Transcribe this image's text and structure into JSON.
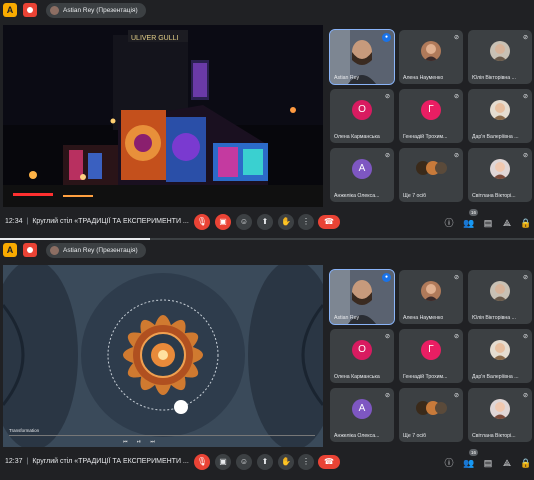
{
  "screens": [
    {
      "presenter_chip": "Astian Rey (Презентація)",
      "time": "12:34",
      "meeting_title": "Круглий стіл «ТРАДИЦІЇ ТА ЕКСПЕРИМЕНТИ ...",
      "participant_count": "16",
      "stage_image": "night-city-led-building",
      "progress_fraction": 0.28
    },
    {
      "presenter_chip": "Astian Rey (Презентація)",
      "time": "12:37",
      "meeting_title": "Круглий стіл «ТРАДИЦІЇ ТА ЕКСПЕРИМЕНТИ ...",
      "participant_count": "16",
      "stage_image": "kaleidoscope-fractal-video",
      "video_label": "Transformation"
    }
  ],
  "participants": [
    {
      "name": "Astian Rey",
      "type": "video",
      "mic": "on"
    },
    {
      "name": "Алена Науменко",
      "type": "photo",
      "mic": "off"
    },
    {
      "name": "Юлія Вікторівна ...",
      "type": "photo",
      "mic": "off"
    },
    {
      "name": "Олена Карманська",
      "type": "letter",
      "letter": "О",
      "color": "#d81b60",
      "mic": "off"
    },
    {
      "name": "Геннадій Трохим...",
      "type": "letter",
      "letter": "Г",
      "color": "#e91e63",
      "mic": "off"
    },
    {
      "name": "Дар'я Валеріївна ...",
      "type": "photo",
      "mic": "off"
    },
    {
      "name": "Анжеліка Олекса...",
      "type": "letter",
      "letter": "А",
      "color": "#7e57c2",
      "mic": "off"
    },
    {
      "name": "Ще 7 осіб",
      "type": "group",
      "mic": "off"
    },
    {
      "name": "Світлана Вікторі...",
      "type": "photo",
      "mic": "off"
    }
  ],
  "icons": {
    "ext": "A",
    "mic_off": "mic-off-icon",
    "camera_off": "camera-off-icon",
    "emoji": "emoji-icon",
    "present": "present-icon",
    "hand": "raise-hand-icon",
    "more": "more-icon",
    "end_call": "end-call-icon",
    "info": "info-icon",
    "people": "people-icon",
    "chat": "chat-icon",
    "activities": "activities-icon",
    "lock": "host-controls-icon"
  },
  "colors": {
    "background": "#202124",
    "tile": "#3c4043",
    "danger": "#ea4335",
    "accent": "#8ab4f8"
  }
}
